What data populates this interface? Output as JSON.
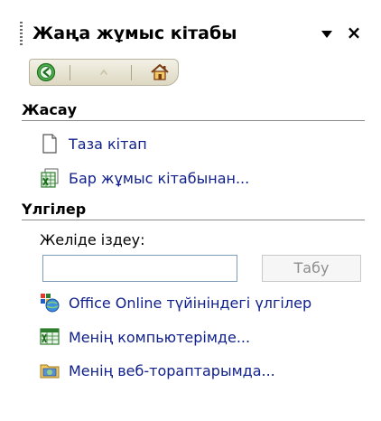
{
  "pane": {
    "title": "Жаңа жұмыс кітабы",
    "dropdown_icon": "dropdown-arrow-icon",
    "close_label": "×"
  },
  "nav": {
    "back_icon": "back-arrow-icon",
    "forward_icon": "forward-arrow-icon",
    "home_icon": "home-icon"
  },
  "create_section": {
    "header": "Жасау",
    "items": [
      {
        "label": "Таза кітап",
        "icon": "blank-document-icon"
      },
      {
        "label": "Бар жұмыс кітабынан...",
        "icon": "workbook-from-existing-icon"
      }
    ]
  },
  "templates_section": {
    "header": "Үлгілер",
    "search_label": "Желіде іздеу:",
    "search_value": "",
    "search_button": "Табу",
    "items": [
      {
        "label": "Office Online түйініндегі үлгілер",
        "icon": "office-online-icon"
      },
      {
        "label": "Менің компьютерімде...",
        "icon": "my-computer-templates-icon"
      },
      {
        "label": "Менің веб-тораптарымда...",
        "icon": "my-websites-icon"
      }
    ]
  },
  "colors": {
    "link": "#10208a",
    "nav_bg": "#ddd8c2",
    "back_icon_green": "#3c9a3c"
  }
}
